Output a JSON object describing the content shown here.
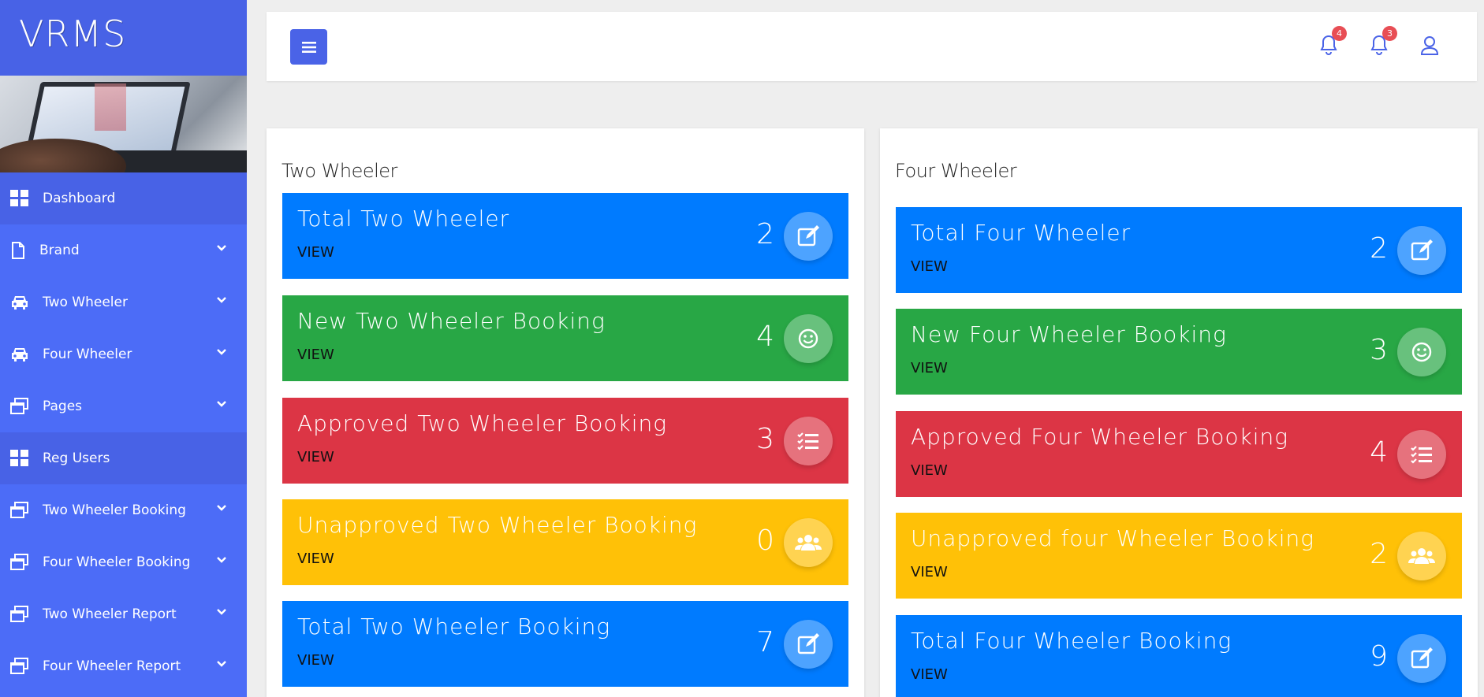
{
  "brand": {
    "logo": "VRMS"
  },
  "sidebar": {
    "items": [
      {
        "label": "Dashboard",
        "icon": "grid-icon",
        "active": true,
        "has_chevron": false
      },
      {
        "label": "Brand",
        "icon": "file-icon",
        "active": false,
        "has_chevron": true
      },
      {
        "label": "Two Wheeler",
        "icon": "car-icon",
        "active": false,
        "has_chevron": true
      },
      {
        "label": "Four Wheeler",
        "icon": "car-icon",
        "active": false,
        "has_chevron": true
      },
      {
        "label": "Pages",
        "icon": "windows-icon",
        "active": false,
        "has_chevron": true
      },
      {
        "label": "Reg Users",
        "icon": "grid-icon",
        "active": true,
        "has_chevron": false
      },
      {
        "label": "Two Wheeler Booking",
        "icon": "windows-icon",
        "active": false,
        "has_chevron": true
      },
      {
        "label": "Four Wheeler Booking",
        "icon": "windows-icon",
        "active": false,
        "has_chevron": true
      },
      {
        "label": "Two Wheeler Report",
        "icon": "windows-icon",
        "active": false,
        "has_chevron": true
      },
      {
        "label": "Four Wheeler Report",
        "icon": "windows-icon",
        "active": false,
        "has_chevron": true
      }
    ]
  },
  "topbar": {
    "notifications_1_badge": "4",
    "notifications_2_badge": "3"
  },
  "colors": {
    "sidebar": "#4c6cf7",
    "sidebar_active": "#4862e6",
    "blue": "#007bff",
    "green": "#28a745",
    "red": "#dc3545",
    "yellow": "#ffc107",
    "badge": "#e84e55"
  },
  "two_wheeler": {
    "title": "Two Wheeler",
    "cards": [
      {
        "title": "Total Two Wheeler",
        "view": "VIEW",
        "count": "2",
        "icon": "edit-icon"
      },
      {
        "title": "New Two Wheeler Booking",
        "view": "VIEW",
        "count": "4",
        "icon": "smile-icon"
      },
      {
        "title": "Approved Two Wheeler Booking",
        "view": "VIEW",
        "count": "3",
        "icon": "checklist-icon"
      },
      {
        "title": "Unapproved Two Wheeler Booking",
        "view": "VIEW",
        "count": "0",
        "icon": "users-icon"
      },
      {
        "title": "Total Two Wheeler Booking",
        "view": "VIEW",
        "count": "7",
        "icon": "edit-icon"
      }
    ]
  },
  "four_wheeler": {
    "title": "Four Wheeler",
    "cards": [
      {
        "title": "Total Four Wheeler",
        "view": "VIEW",
        "count": "2",
        "icon": "edit-icon"
      },
      {
        "title": "New Four Wheeler Booking",
        "view": "VIEW",
        "count": "3",
        "icon": "smile-icon"
      },
      {
        "title": "Approved Four Wheeler Booking",
        "view": "VIEW",
        "count": "4",
        "icon": "checklist-icon"
      },
      {
        "title": "Unapproved four Wheeler Booking",
        "view": "VIEW",
        "count": "2",
        "icon": "users-icon"
      },
      {
        "title": "Total Four Wheeler Booking",
        "view": "VIEW",
        "count": "9",
        "icon": "edit-icon"
      }
    ]
  }
}
